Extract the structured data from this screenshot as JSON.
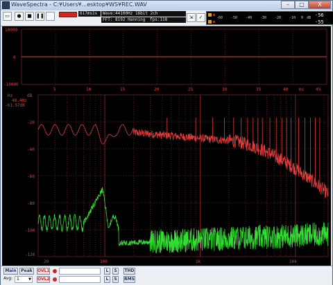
{
  "window": {
    "title": "WaveSpectra - C:¥Users¥...esktop¥WS¥REC.WAV",
    "minimize": "–",
    "maximize": "□",
    "close": "X"
  },
  "toolbar": {
    "timer": "617ms1s",
    "wave_info": "Wave:44100Hz 16bit 2ch",
    "fft_info": "FFT: 8192 Hanning",
    "fps": "fps:118"
  },
  "level_meter": {
    "top_value": "-56",
    "bottom_value": "-55",
    "scale_unit": "dB",
    "scale_ticks": [
      "-60",
      "-50",
      "-40",
      "-30",
      "-20",
      "-10",
      "0"
    ],
    "top_marker": "▮",
    "bottom_marker": "▮"
  },
  "waveform": {
    "y_labels": [
      "10000",
      "0",
      "-10000"
    ],
    "x_labels": [
      "5",
      "10",
      "15",
      "20",
      "25",
      "30",
      "35",
      "40",
      "45"
    ],
    "x_unit": "ms"
  },
  "spectrum": {
    "cursor_hz_label": "Hz",
    "cursor_freq": "48.4Hz",
    "cursor_level": "-61.57dB",
    "y_labels": [
      "dB",
      "-20",
      "-40",
      "-60",
      "-80",
      "-100",
      "-120"
    ],
    "x_labels": [
      "20",
      "100",
      "1k",
      "10k"
    ],
    "colors": {
      "ch1": "#e83c3c",
      "ch2": "#33dd33",
      "grid": "#7a2a2a"
    }
  },
  "bottom": {
    "main_btn": "Main",
    "peak_btn": "Peak",
    "ovl1": "OVL1",
    "ovl2": "OVL2",
    "avg_label": "Avg:",
    "avg_value": "1",
    "l_btn": "L",
    "s_btn": "S",
    "thd_btn": "THD",
    "rms_btn": "RMS"
  }
}
